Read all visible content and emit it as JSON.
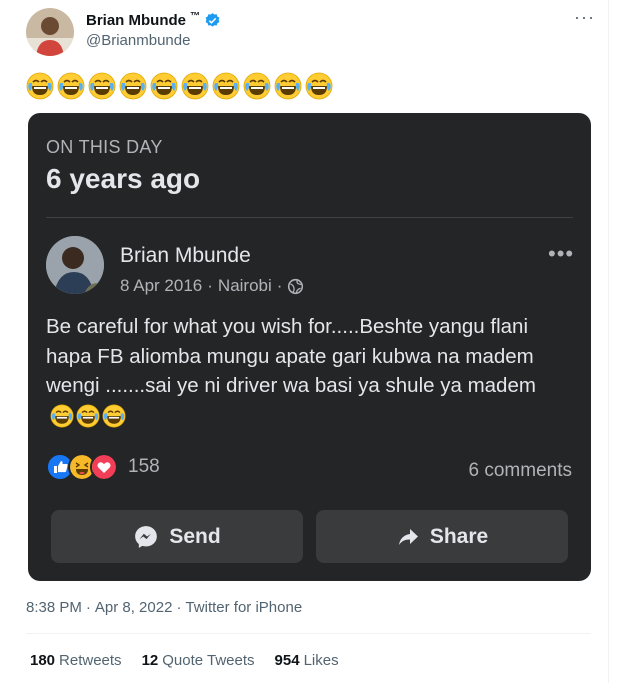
{
  "author": {
    "name": "Brian Mbunde",
    "tm": "™",
    "handle": "@Brianmbunde",
    "verified": true
  },
  "tweet_emoji_count": 10,
  "card": {
    "header_small": "ON THIS DAY",
    "header_big": "6 years ago",
    "post": {
      "author": "Brian Mbunde",
      "date": "8 Apr 2016",
      "location": "Nairobi",
      "text": "Be careful for what you wish for.....Beshte yangu flani hapa FB aliomba mungu apate gari kubwa na madem wengi .......sai ye ni driver wa basi ya shule ya madem",
      "reaction_count": "158",
      "comments": "6 comments"
    },
    "send_label": "Send",
    "share_label": "Share"
  },
  "footer": {
    "time": "8:38 PM",
    "date": "Apr 8, 2022",
    "source": "Twitter for iPhone",
    "retweets_count": "180",
    "retweets_label": "Retweets",
    "quote_count": "12",
    "quote_label": "Quote Tweets",
    "likes_count": "954",
    "likes_label": "Likes"
  },
  "colors": {
    "card_bg": "#242526",
    "verified": "#1d9bf0",
    "secondary_text": "#536471"
  }
}
